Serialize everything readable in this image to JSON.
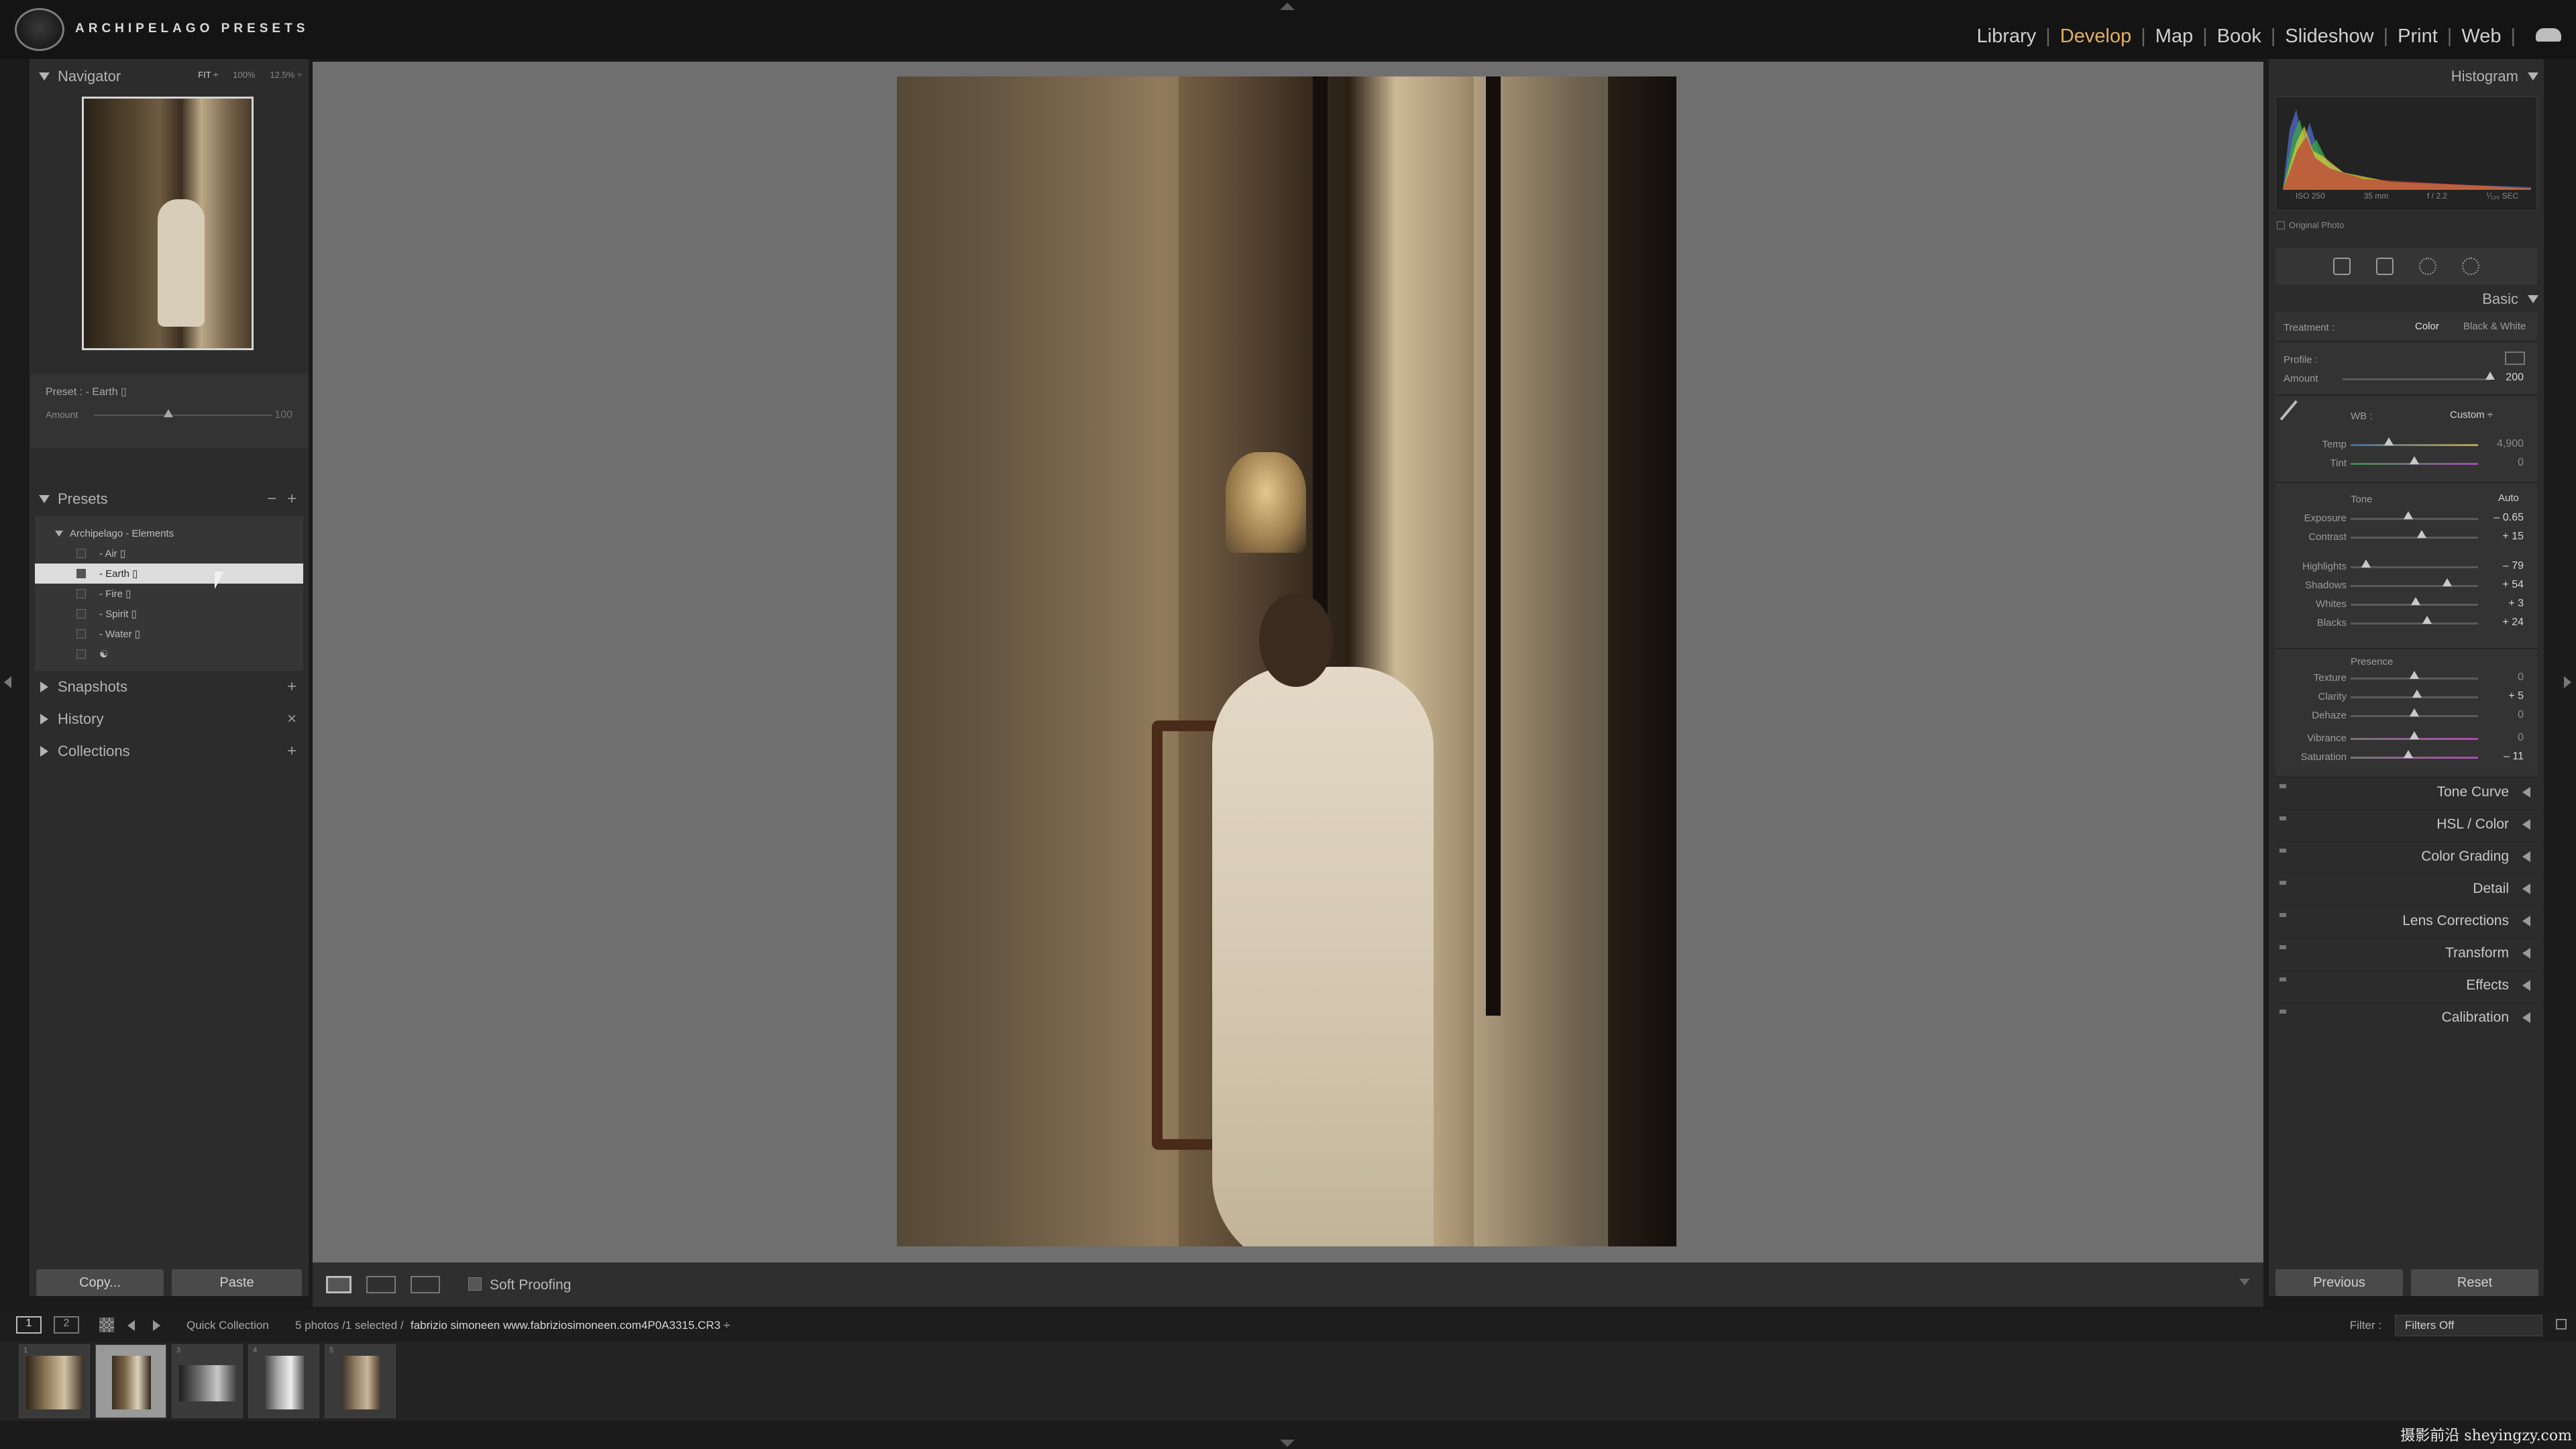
{
  "brand": {
    "name": "ARCHIPELAGO PRESETS"
  },
  "modules": [
    {
      "label": "Library"
    },
    {
      "label": "Develop",
      "active": true
    },
    {
      "label": "Map"
    },
    {
      "label": "Book"
    },
    {
      "label": "Slideshow"
    },
    {
      "label": "Print"
    },
    {
      "label": "Web"
    }
  ],
  "navigator": {
    "title": "Navigator",
    "zoom": [
      "FIT ÷",
      "100%",
      "12.5% ÷"
    ]
  },
  "preset_amount": {
    "preset_label": "Preset : - Earth ▯",
    "amount_label": "Amount",
    "amount_value": "100",
    "amount_fraction": 0.39
  },
  "presets": {
    "title": "Presets",
    "minus": "−",
    "plus": "+",
    "folder": "Archipelago - Elements",
    "items": [
      {
        "label": "- Air ▯"
      },
      {
        "label": "- Earth ▯",
        "selected": true
      },
      {
        "label": "- Fire ▯"
      },
      {
        "label": "- Spirit ▯"
      },
      {
        "label": "- Water ▯"
      },
      {
        "label": "☯"
      }
    ]
  },
  "left_sections": [
    {
      "label": "Snapshots",
      "btn": "+"
    },
    {
      "label": "History",
      "btn": "×"
    },
    {
      "label": "Collections",
      "btn": "+"
    }
  ],
  "left_buttons": {
    "copy": "Copy...",
    "paste": "Paste"
  },
  "toolbar": {
    "soft_proofing": "Soft Proofing"
  },
  "histogram": {
    "title": "Histogram",
    "iso": "ISO 250",
    "focal": "35 mm",
    "aperture": "f / 2.2",
    "shutter": "⅟₁₂₅ SEC",
    "original_photo": "Original Photo"
  },
  "basic": {
    "title": "Basic",
    "treatment_label": "Treatment :",
    "treatment_color": "Color",
    "treatment_bw": "Black & White",
    "profile_label": "Profile :",
    "amount_label": "Amount",
    "amount_value": "200",
    "amount_fraction": 1.0,
    "wb_label": "WB :",
    "wb_value": "Custom ÷",
    "sliders_wb": [
      {
        "label": "Temp",
        "value": "4,900",
        "fraction": 0.3,
        "kind": "temp",
        "dim": true
      },
      {
        "label": "Tint",
        "value": "0",
        "fraction": 0.5,
        "kind": "tint",
        "dim": true
      }
    ],
    "tone_label": "Tone",
    "auto_label": "Auto",
    "sliders_tone": [
      {
        "label": "Exposure",
        "value": "– 0.65",
        "fraction": 0.45
      },
      {
        "label": "Contrast",
        "value": "+ 15",
        "fraction": 0.56
      }
    ],
    "sliders_tone2": [
      {
        "label": "Highlights",
        "value": "– 79",
        "fraction": 0.12
      },
      {
        "label": "Shadows",
        "value": "+ 54",
        "fraction": 0.76
      },
      {
        "label": "Whites",
        "value": "+ 3",
        "fraction": 0.51
      },
      {
        "label": "Blacks",
        "value": "+ 24",
        "fraction": 0.6
      }
    ],
    "presence_label": "Presence",
    "sliders_presence": [
      {
        "label": "Texture",
        "value": "0",
        "fraction": 0.5,
        "dim": true
      },
      {
        "label": "Clarity",
        "value": "+ 5",
        "fraction": 0.52
      },
      {
        "label": "Dehaze",
        "value": "0",
        "fraction": 0.5,
        "dim": true
      }
    ],
    "sliders_color": [
      {
        "label": "Vibrance",
        "value": "0",
        "fraction": 0.5,
        "kind": "vib",
        "dim": true
      },
      {
        "label": "Saturation",
        "value": "– 11",
        "fraction": 0.45,
        "kind": "vib"
      }
    ]
  },
  "right_sections": [
    {
      "label": "Tone Curve"
    },
    {
      "label": "HSL / Color"
    },
    {
      "label": "Color Grading"
    },
    {
      "label": "Detail"
    },
    {
      "label": "Lens Corrections"
    },
    {
      "label": "Transform"
    },
    {
      "label": "Effects"
    },
    {
      "label": "Calibration"
    }
  ],
  "right_buttons": {
    "previous": "Previous",
    "reset": "Reset"
  },
  "filmstrip_bar": {
    "screen1": "1",
    "screen2": "2",
    "source": "Quick Collection",
    "count": "5 photos /1 selected /",
    "file": "fabrizio simoneen  www.fabriziosimoneen.com4P0A3315.CR3 ÷",
    "filter_label": "Filter :",
    "filter_value": "Filters Off"
  },
  "thumbnails": [
    {
      "num": "1"
    },
    {
      "num": "2",
      "selected": true
    },
    {
      "num": "3"
    },
    {
      "num": "4"
    },
    {
      "num": "5"
    }
  ],
  "watermark": "摄影前沿 sheyingzy.com",
  "colors": {
    "accent": "#e3b05d",
    "panel": "#2c2c2c",
    "canvas": "#6f6f6f"
  }
}
